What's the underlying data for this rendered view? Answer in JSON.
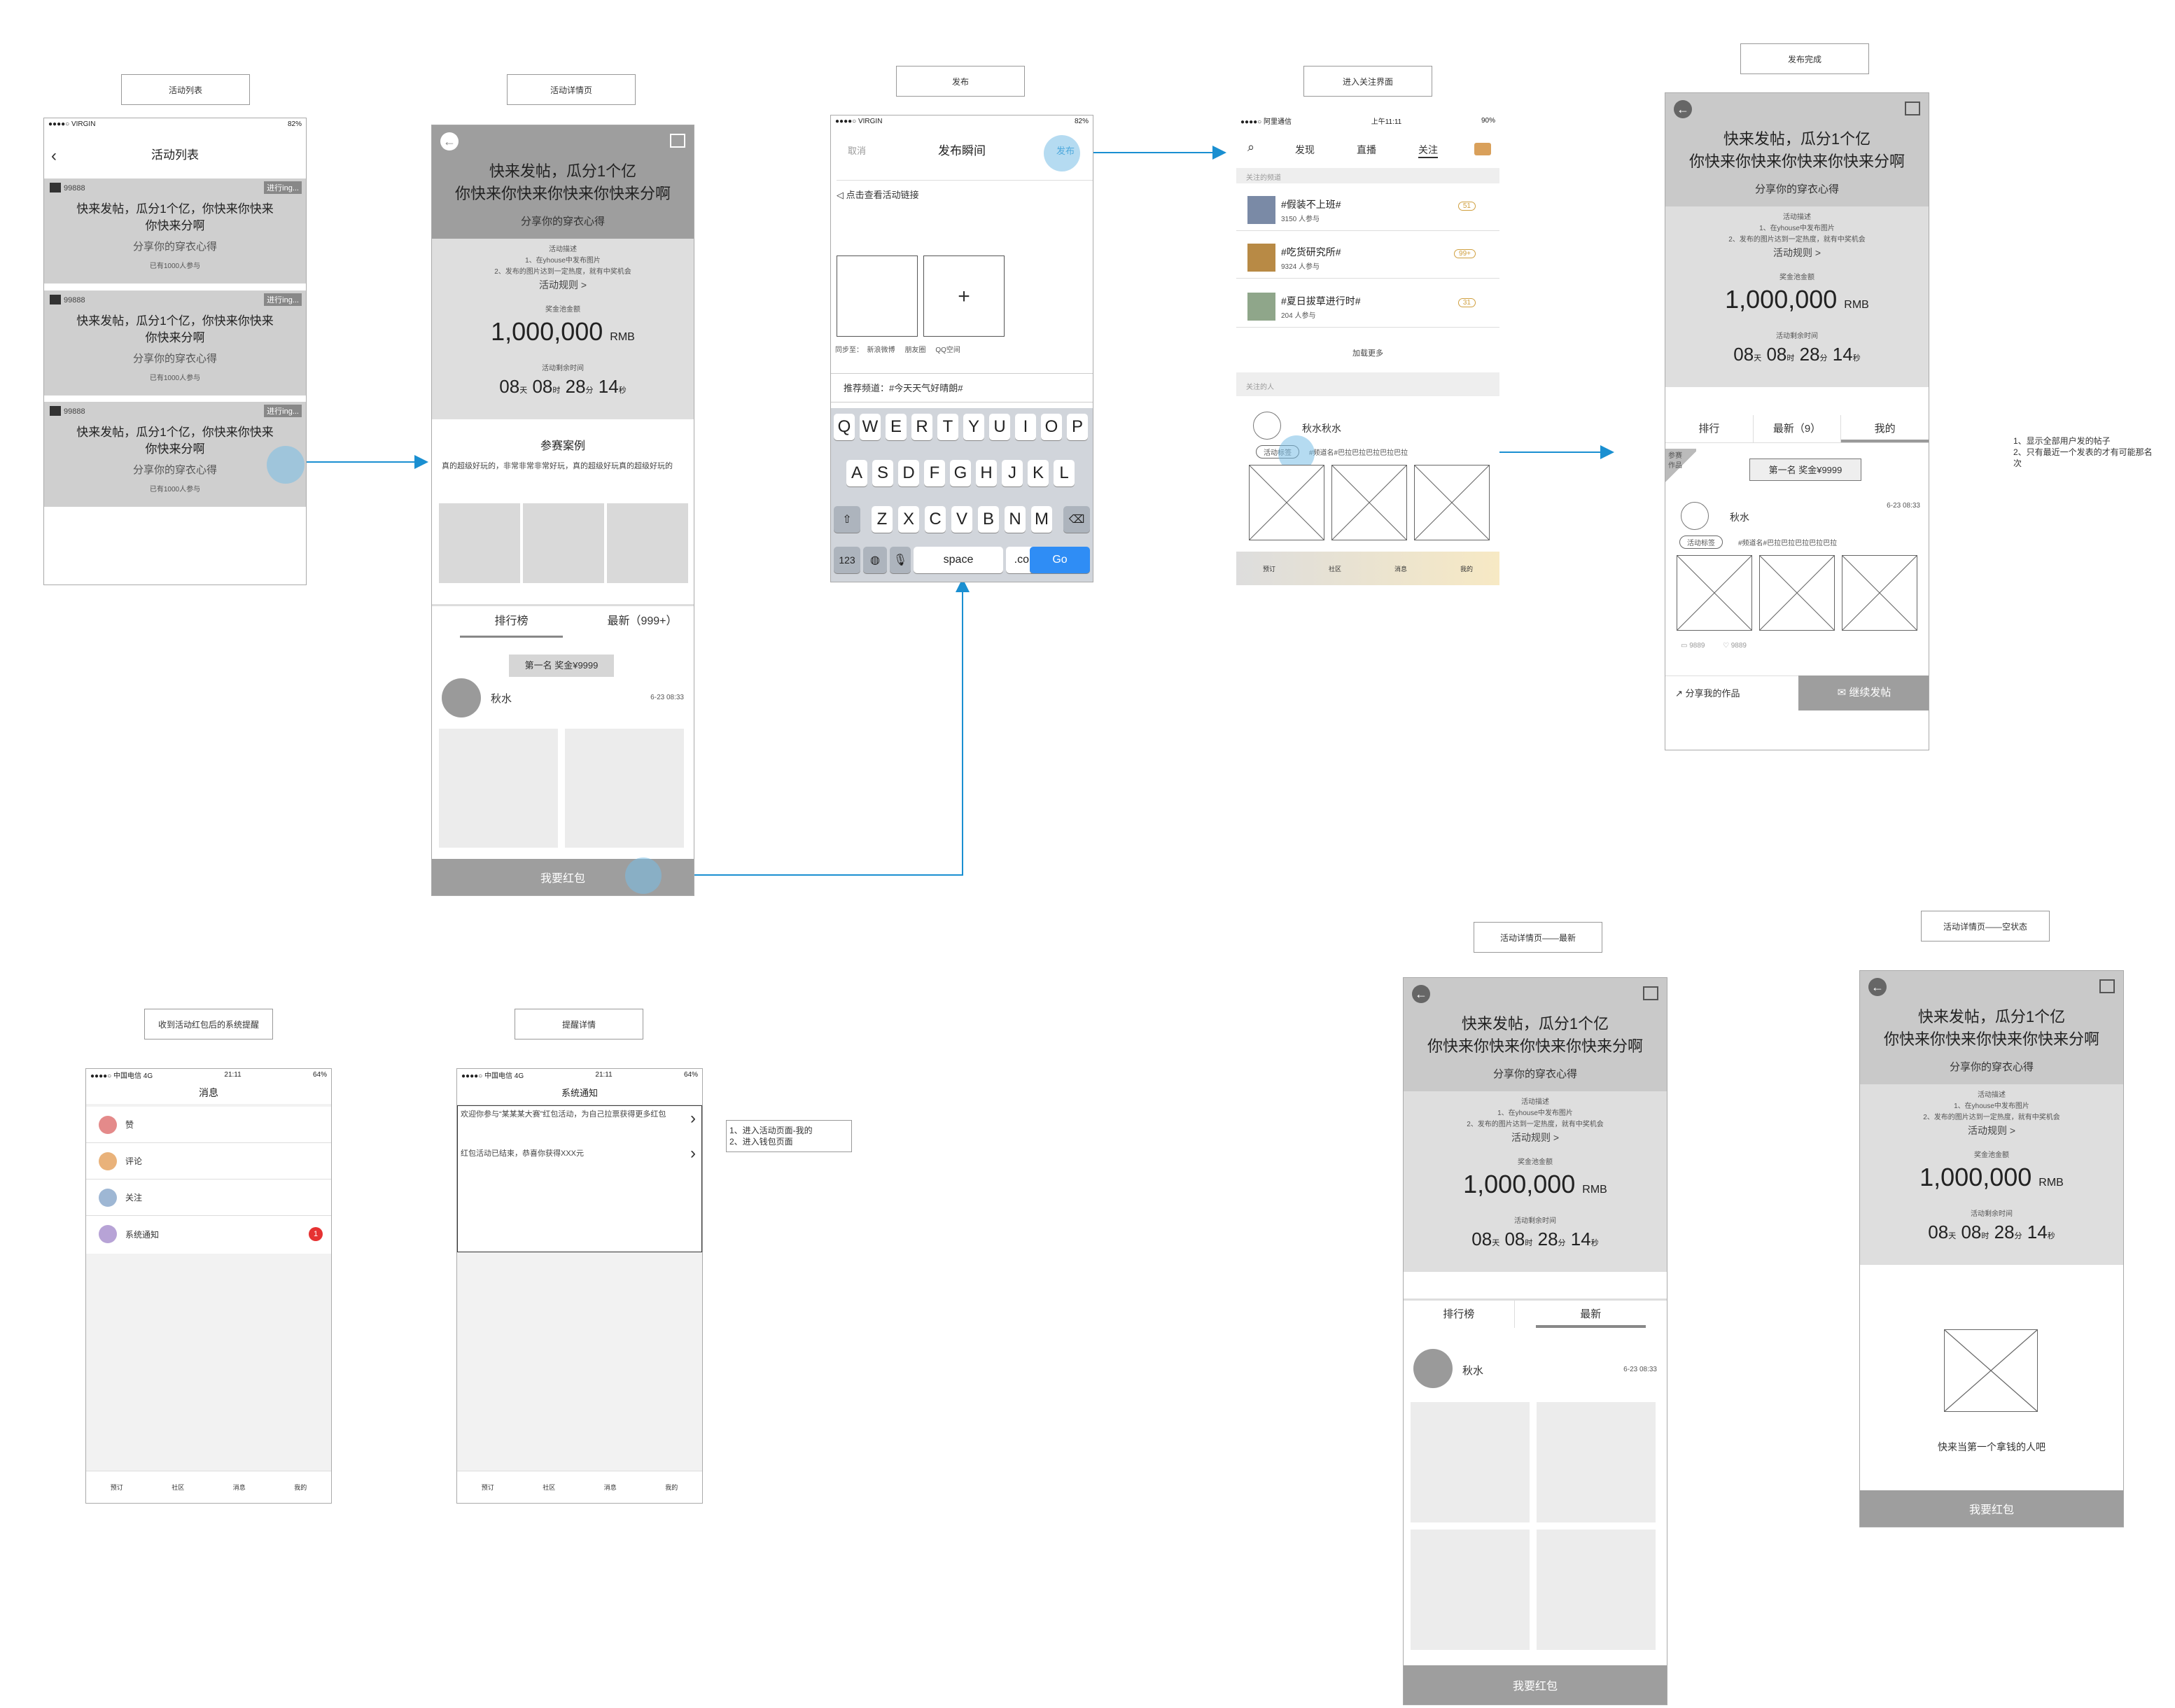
{
  "labels": {
    "list": "活动列表",
    "detail": "活动详情页",
    "publish": "发布",
    "follow": "进入关注界面",
    "done": "发布完成",
    "latest": "活动详情页——最新",
    "empty": "活动详情页——空状态",
    "notice": "收到活动红包后的系统提醒",
    "notice_detail": "提醒详情"
  },
  "notes": {
    "done": [
      "1、显示全部用户发的帖子",
      "2、只有最近一个发表的才有可能那名",
      "次"
    ],
    "notice": [
      "1、进入活动页面-我的",
      "2、进入钱包页面"
    ]
  },
  "status": {
    "carrier_virgin": "●●●●○ VIRGIN",
    "battery": "82%",
    "carrier_cm": "●●●●○ 阿里通信",
    "time_am": "上午11:11",
    "battery_90": "90%",
    "carrier_ct": "●●●●○ 中国电信  4G",
    "time_21": "21:11",
    "battery_64": "64%"
  },
  "activity": {
    "count": "99888",
    "badge": "进行ing...",
    "headline": "快来发帖，瓜分1个亿，你快来你快来你快来分啊",
    "headline_1": "快来发帖，瓜分1个亿，你快来你快来",
    "headline_2": "你快来分啊",
    "sub": "分享你的穿衣心得",
    "joined": "已有1000人参与",
    "title_1": "快来发帖，瓜分1个亿",
    "title_2": "你快来你快来你快来你快来分啊",
    "desc_label": "活动描述",
    "desc_1": "1、在yhouse中发布图片",
    "desc_2": "2、发布的图片达到一定热度，就有中奖机会",
    "rules": "活动规则 >",
    "pool_label": "奖金池金额",
    "pool": "1,000,000",
    "pool_unit": "RMB",
    "remain_label": "活动剩余时间",
    "d": "08",
    "d_u": "天",
    "h": "08",
    "h_u": "时",
    "m": "28",
    "m_u": "分",
    "s": "14",
    "s_u": "秒",
    "case_title": "参赛案例",
    "case_text": "真的超级好玩的，非常非常非常好玩，真的超级好玩真的超级好玩的",
    "tab_rank": "排行榜",
    "tab_new": "最新（999+）",
    "tab_new_short": "最新",
    "tab_rank_short": "排行",
    "tab_new_9": "最新（9）",
    "tab_mine": "我的",
    "first_prize": "第一名 奖金¥9999",
    "user": "秋水",
    "date": "6-23 08:33",
    "cta": "我要红包",
    "entry": "参赛\n作品",
    "share": "分享我的作品",
    "continue": "继续发帖",
    "empty_text": "快来当第一个拿钱的人吧",
    "likes": "9889",
    "comments": "9889"
  },
  "list_screen": {
    "title": "活动列表"
  },
  "publish": {
    "cancel": "取消",
    "title": "发布瞬间",
    "post": "发布",
    "link": "点击查看活动链接",
    "plus": "+",
    "sync": "同步至：  新浪微博     朋友圈     QQ空间",
    "channel": "推荐频道：#今天天气好晴朗#",
    "row1": [
      "Q",
      "W",
      "E",
      "R",
      "T",
      "Y",
      "U",
      "I",
      "O",
      "P"
    ],
    "row2": [
      "A",
      "S",
      "D",
      "F",
      "G",
      "H",
      "J",
      "K",
      "L"
    ],
    "row3": [
      "Z",
      "X",
      "C",
      "V",
      "B",
      "N",
      "M"
    ],
    "k123": "123",
    "space": "space",
    "com": ".com",
    "go": "Go"
  },
  "follow": {
    "tab1": "发现",
    "tab2": "直播",
    "tab3": "关注",
    "sec1": "关注的频道",
    "ch1": "#假装不上班#",
    "ch1_n": "3150 人参与",
    "ch1_b": "51",
    "ch2": "#吃货研究所#",
    "ch2_n": "9324 人参与",
    "ch2_b": "99+",
    "ch3": "#夏日拔草进行时#",
    "ch3_n": "204 人参与",
    "ch3_b": "31",
    "more": "加载更多",
    "sec2": "关注的人",
    "person": "秋水秋水",
    "tag": "活动标签",
    "tag_text": "#频道名#巴拉巴拉巴拉巴拉巴拉",
    "tabs": [
      "预订",
      "社区",
      "消息",
      "我的"
    ]
  },
  "messages": {
    "title": "消息",
    "items": [
      "赞",
      "评论",
      "关注",
      "系统通知"
    ],
    "badge": "1",
    "sys_title": "系统通知",
    "sys_1": "欢迎你参与“某某某大赛”红包活动，为自己拉票获得更多红包",
    "sys_2": "红包活动已结束，恭喜你获得XXX元",
    "tabs": [
      "预订",
      "社区",
      "消息",
      "我的"
    ]
  },
  "colors": {
    "accent": "#1a8fd1",
    "panel": "#cfcfcf",
    "dark_panel": "#9e9e9e",
    "go": "#2f8df5",
    "badge_red": "#e63232"
  }
}
